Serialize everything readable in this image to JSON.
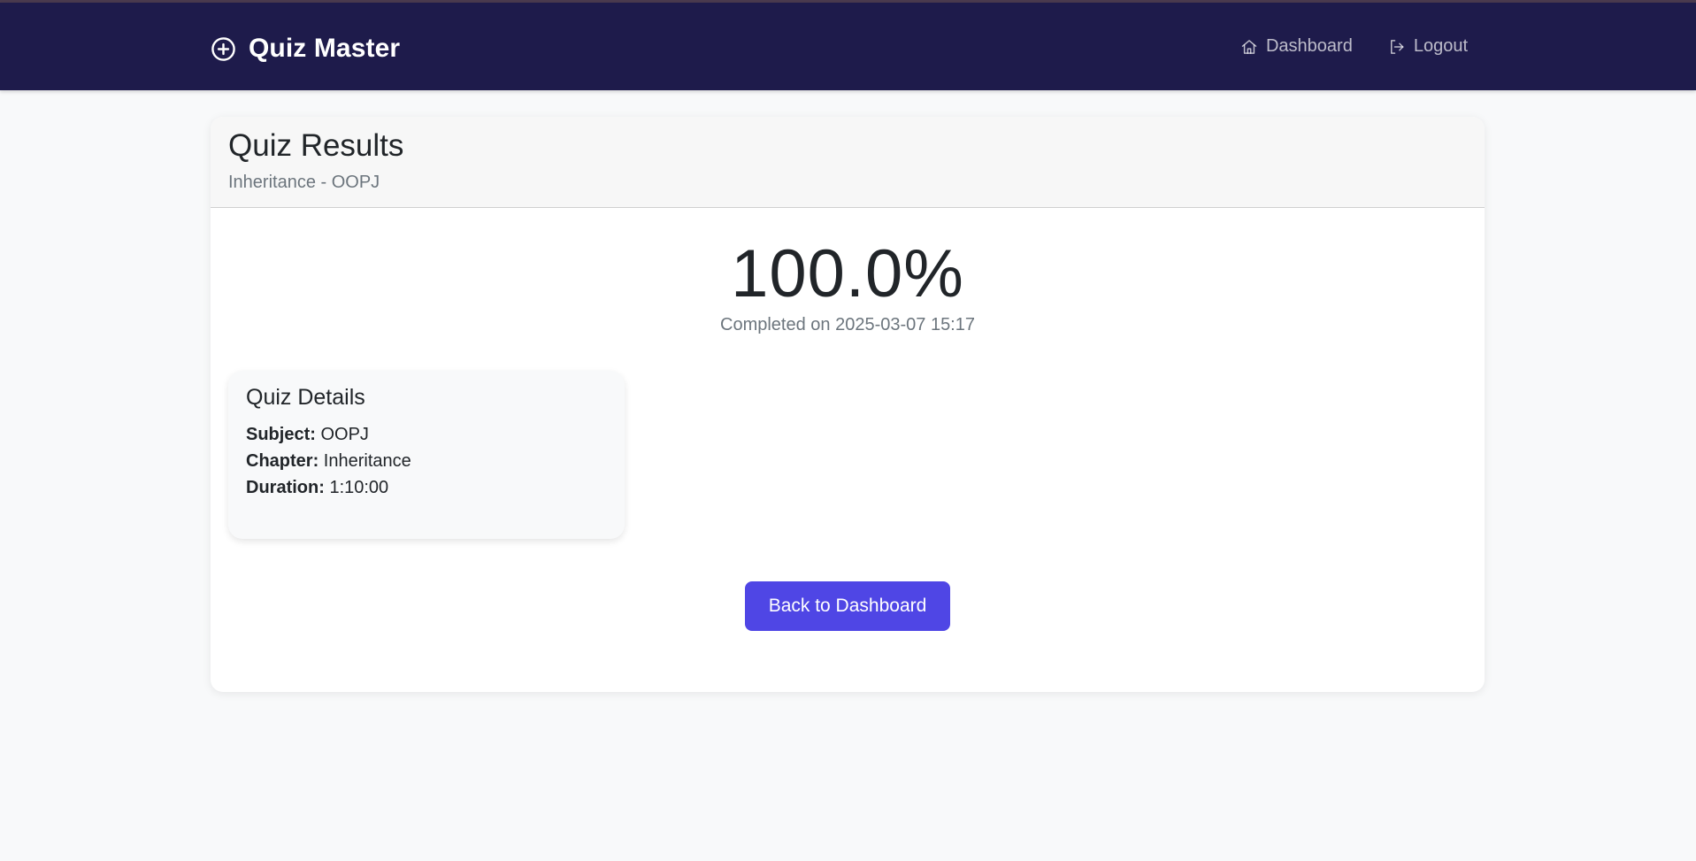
{
  "navbar": {
    "brand": "Quiz Master",
    "brand_icon": "plus-circle-icon",
    "links": [
      {
        "label": "Dashboard",
        "icon": "home-icon"
      },
      {
        "label": "Logout",
        "icon": "logout-icon"
      }
    ],
    "background_color": "#1e1b4b"
  },
  "results": {
    "title": "Quiz Results",
    "subtitle": "Inheritance - OOPJ",
    "score": "100.0%",
    "completed": "Completed on 2025-03-07 15:17"
  },
  "details": {
    "title": "Quiz Details",
    "subject_label": "Subject:",
    "subject_value": "OOPJ",
    "chapter_label": "Chapter:",
    "chapter_value": "Inheritance",
    "duration_label": "Duration:",
    "duration_value": "1:10:00"
  },
  "actions": {
    "back_label": "Back to Dashboard",
    "accent_color": "#4f46e5"
  }
}
